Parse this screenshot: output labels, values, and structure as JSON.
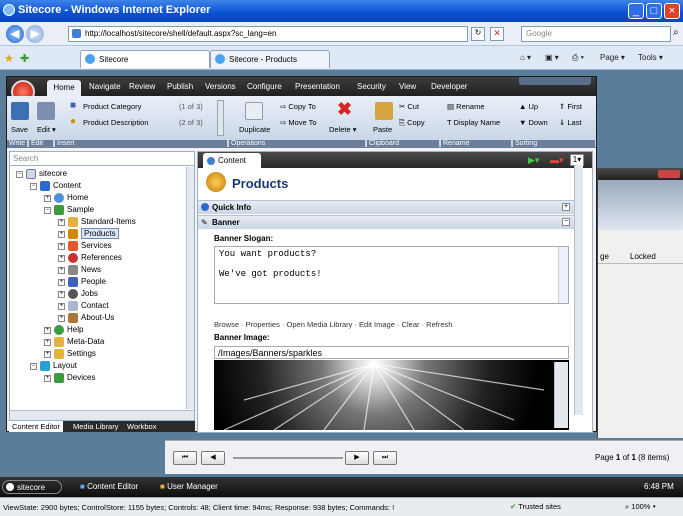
{
  "window": {
    "title": "Sitecore - Windows Internet Explorer"
  },
  "address": {
    "url": "http://localhost/sitecore/shell/default.aspx?sc_lang=en",
    "search_placeholder": "Google"
  },
  "ie_tabs": [
    {
      "label": "Sitecore"
    },
    {
      "label": "Sitecore - Products"
    }
  ],
  "ie_commands": {
    "page": "Page",
    "tools": "Tools"
  },
  "ribbon": {
    "tabs": [
      "Home",
      "Navigate",
      "Review",
      "Publish",
      "Versions",
      "Configure",
      "Presentation",
      "Security",
      "View",
      "Developer"
    ],
    "save": "Save",
    "edit": "Edit",
    "insert1": "Product Category",
    "insert1_count": "(1 of 3)",
    "insert2": "Product Description",
    "insert2_count": "(2 of 3)",
    "duplicate": "Duplicate",
    "copy_to": "Copy To",
    "move_to": "Move To",
    "delete": "Delete",
    "paste": "Paste",
    "cut": "Cut",
    "copy": "Copy",
    "rename": "Rename",
    "display_name": "Display Name",
    "up": "Up",
    "down": "Down",
    "first": "First",
    "last": "Last",
    "groups": [
      "Write",
      "Edit",
      "Insert",
      "Operations",
      "Clipboard",
      "Rename",
      "Sorting"
    ]
  },
  "tree": {
    "search_placeholder": "Search",
    "nodes": [
      "sitecore",
      "Content",
      "Home",
      "Sample",
      "Standard-Items",
      "Products",
      "Services",
      "References",
      "News",
      "People",
      "Jobs",
      "Contact",
      "About-Us",
      "Help",
      "Meta-Data",
      "Settings",
      "Layout",
      "Devices"
    ]
  },
  "bottom_tabs": [
    "Content Editor",
    "Media Library",
    "Workbox"
  ],
  "content": {
    "tab": "Content",
    "title": "Products",
    "quick_info": "Quick Info",
    "banner_section": "Banner",
    "slogan_label": "Banner Slogan:",
    "slogan": "You want products?\n\nWe've got products!",
    "actions": "Browse · Properties · Open Media Library · Edit Image · Clear · Refresh",
    "image_label": "Banner Image:",
    "image_path": "/Images/Banners/sparkles"
  },
  "user_manager": {
    "col_age": "ge",
    "col_locked": "Locked"
  },
  "pager": {
    "text_prefix": "Page ",
    "page": "1",
    "of": " of ",
    "total": "1",
    "items": " (8 items)",
    "first": "⏮",
    "prev": "◀",
    "next": "▶",
    "last": "⏭"
  },
  "taskbar": {
    "start": "sitecore",
    "item1": "Content Editor",
    "item2": "User Manager",
    "time": "6:48 PM"
  },
  "status": {
    "text": "ViewState: 2900 bytes; ControlStore: 1155 bytes; Controls: 48; Client time: 94ms; Response: 938 bytes; Commands: !",
    "zone": "Trusted sites",
    "zoom": "100%"
  },
  "colors": {
    "accent": "#0a4fd1",
    "ribbon": "#c5d3e6",
    "dark": "#202020"
  }
}
